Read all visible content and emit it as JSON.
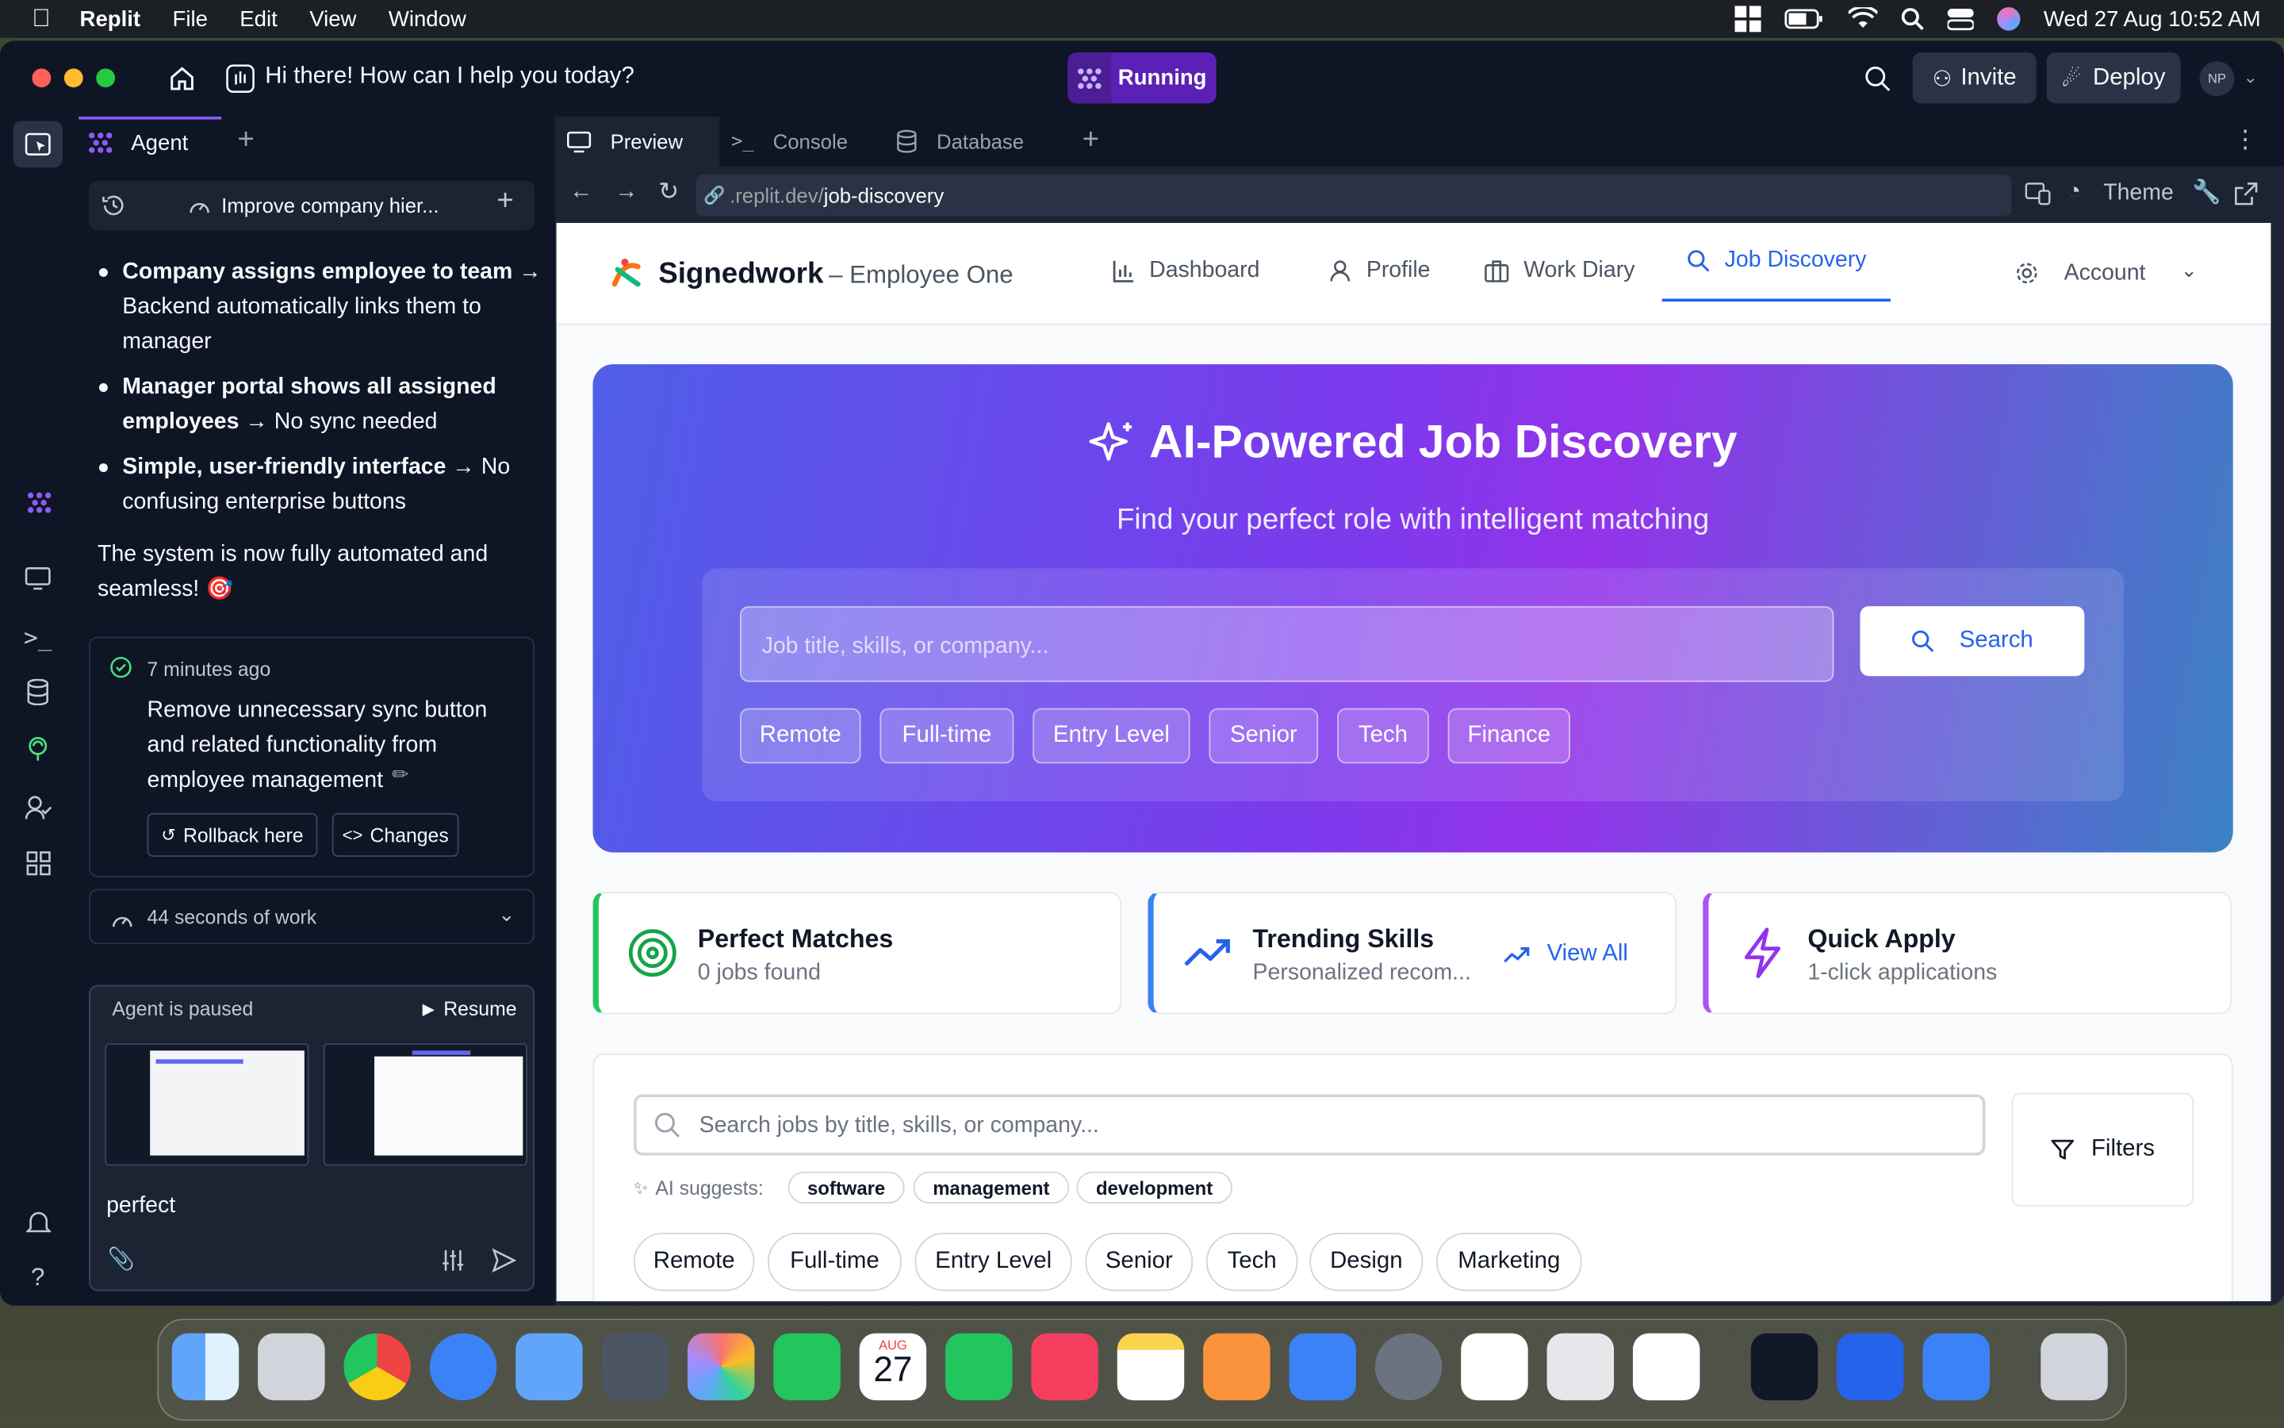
{
  "menubar": {
    "app": "Replit",
    "items": [
      "File",
      "Edit",
      "View",
      "Window"
    ],
    "datetime": "Wed 27 Aug  10:52 AM"
  },
  "titlebar": {
    "greeting": "Hi there! How can I help you today?",
    "status": "Running",
    "invite": "Invite",
    "deploy": "Deploy",
    "avatar": "NP"
  },
  "agent": {
    "tab": "Agent",
    "thread_title": "Improve company hier...",
    "bullets": [
      {
        "bold": "Company assigns employee to team",
        "rest": " → Backend automatically links them to manager"
      },
      {
        "bold": "Manager portal shows all assigned employees",
        "rest": " → No sync needed"
      },
      {
        "bold": "Simple, user-friendly interface",
        "rest": " → No confusing enterprise buttons"
      }
    ],
    "summary": "The system is now fully automated and seamless! 🎯",
    "checkpoint": {
      "time": "7 minutes ago",
      "message": "Remove unnecessary sync button and related functionality from employee management",
      "rollback": "Rollback here",
      "changes": "Changes"
    },
    "work": "44 seconds of work",
    "paused": "Agent is paused",
    "resume": "Resume",
    "input_value": "perfect"
  },
  "preview": {
    "tabs": [
      "Preview",
      "Console",
      "Database"
    ],
    "url_prefix": ".replit.dev/",
    "url_path": "job-discovery",
    "theme": "Theme"
  },
  "app": {
    "brand": "Signedwork",
    "subtitle": "– Employee One",
    "nav": [
      "Dashboard",
      "Profile",
      "Work Diary",
      "Job Discovery"
    ],
    "account": "Account",
    "hero": {
      "title": "AI-Powered Job Discovery",
      "subtitle": "Find your perfect role with intelligent matching",
      "placeholder": "Job title, skills, or company...",
      "search": "Search",
      "chips": [
        "Remote",
        "Full-time",
        "Entry Level",
        "Senior",
        "Tech",
        "Finance"
      ]
    },
    "cards": [
      {
        "title": "Perfect Matches",
        "sub": "0 jobs found"
      },
      {
        "title": "Trending Skills",
        "sub": "Personalized recom...",
        "action": "View All"
      },
      {
        "title": "Quick Apply",
        "sub": "1-click applications"
      }
    ],
    "search2_placeholder": "Search jobs by title, skills, or company...",
    "filters": "Filters",
    "ai_suggests": "AI suggests:",
    "suggestions": [
      "software",
      "management",
      "development"
    ],
    "chips2": [
      "Remote",
      "Full-time",
      "Entry Level",
      "Senior",
      "Tech",
      "Design",
      "Marketing"
    ]
  },
  "dock": {
    "calendar_month": "AUG",
    "calendar_day": "27"
  },
  "colors": {
    "accent": "#6d28d9",
    "replit_bg": "#0e1525",
    "link": "#2563eb"
  }
}
